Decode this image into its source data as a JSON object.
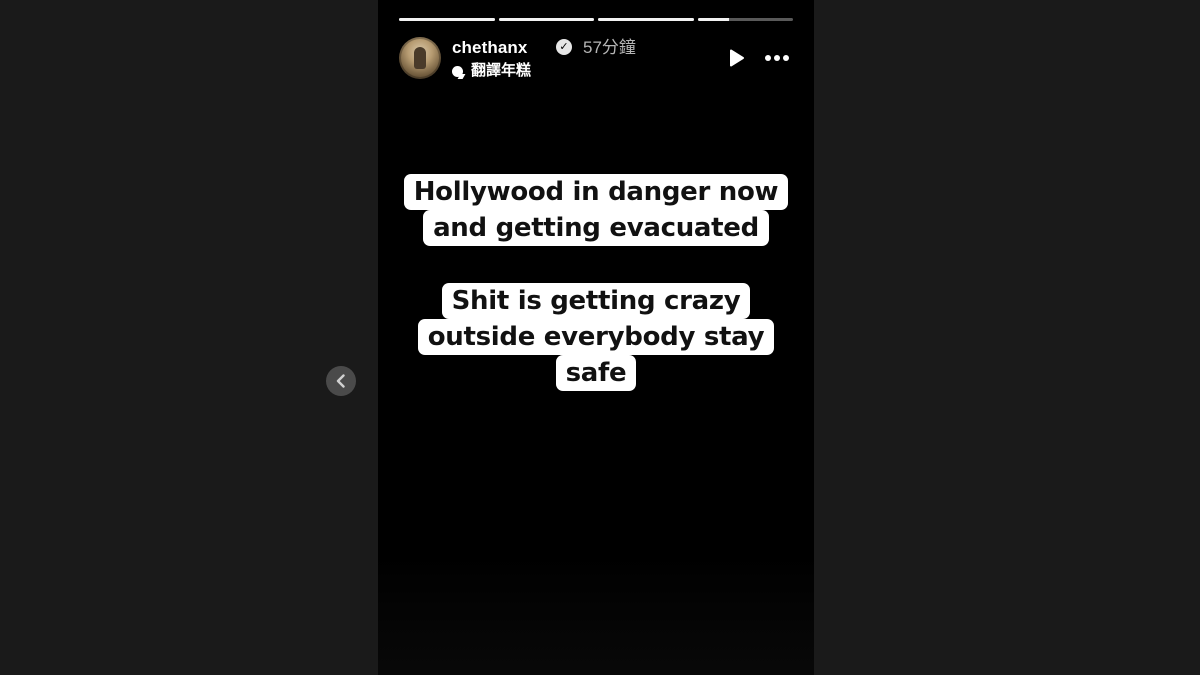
{
  "story": {
    "progress": [
      1,
      1,
      1,
      0.33
    ],
    "user": {
      "username": "chethanx",
      "verified_icon": "verified-badge-icon",
      "time": "57分鐘",
      "translate_label": "翻譯年糕"
    },
    "controls": {
      "play_icon": "play-icon",
      "more_icon": "more-options-icon",
      "prev_icon": "chevron-left-icon"
    },
    "captions": [
      {
        "lines": [
          "Hollywood in danger now",
          "and getting evacuated"
        ]
      },
      {
        "lines": [
          "Shit is getting crazy",
          "outside everybody stay",
          "safe"
        ]
      }
    ]
  },
  "colors": {
    "page_background": "#1a1a1a",
    "story_background": "#000000",
    "caption_background": "#ffffff",
    "caption_text": "#111111"
  }
}
